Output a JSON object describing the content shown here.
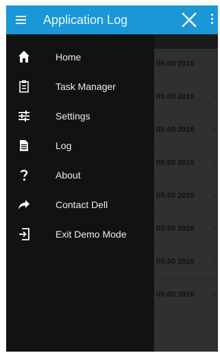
{
  "header": {
    "title": "Application Log",
    "menu_icon": "hamburger-icon",
    "close_icon": "close-icon",
    "overflow_icon": "kebab-icon",
    "color": "#1a97d6"
  },
  "drawer": {
    "items": [
      {
        "label": "Home",
        "icon": "home-icon"
      },
      {
        "label": "Task Manager",
        "icon": "clipboard-icon"
      },
      {
        "label": "Settings",
        "icon": "sliders-icon"
      },
      {
        "label": "Log",
        "icon": "document-icon"
      },
      {
        "label": "About",
        "icon": "question-icon"
      },
      {
        "label": "Contact Dell",
        "icon": "share-arrow-icon"
      },
      {
        "label": "Exit Demo Mode",
        "icon": "exit-icon"
      }
    ]
  },
  "log": {
    "rows": [
      {
        "timestamp": "05:00 2016"
      },
      {
        "timestamp": "05:00 2016"
      },
      {
        "timestamp": "05:00 2016"
      },
      {
        "timestamp": "05:00 2016"
      },
      {
        "timestamp": "05:00 2016"
      },
      {
        "timestamp": "05:00 2016"
      },
      {
        "timestamp": "05:00 2016"
      },
      {
        "timestamp": "05:00 2016"
      }
    ]
  }
}
